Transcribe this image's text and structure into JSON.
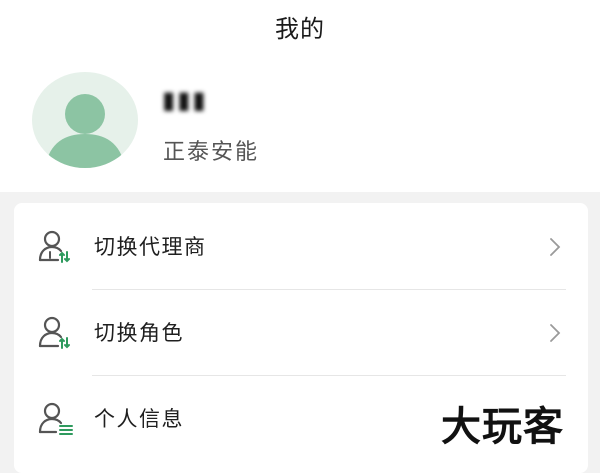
{
  "header": {
    "title": "我的"
  },
  "profile": {
    "name": "▮▮▮",
    "company": "正泰安能",
    "avatar_icon": "user-avatar-icon"
  },
  "menu": {
    "items": [
      {
        "label": "切换代理商",
        "icon": "switch-agent-icon",
        "has_chevron": true
      },
      {
        "label": "切换角色",
        "icon": "switch-role-icon",
        "has_chevron": true
      },
      {
        "label": "个人信息",
        "icon": "personal-info-icon",
        "has_chevron": false
      }
    ]
  },
  "watermark": {
    "text": "大玩客"
  },
  "colors": {
    "accent_green": "#2f9a5e",
    "icon_gray": "#555555",
    "avatar_bg": "#e6f1ea",
    "avatar_figure": "#8cc4a3"
  }
}
